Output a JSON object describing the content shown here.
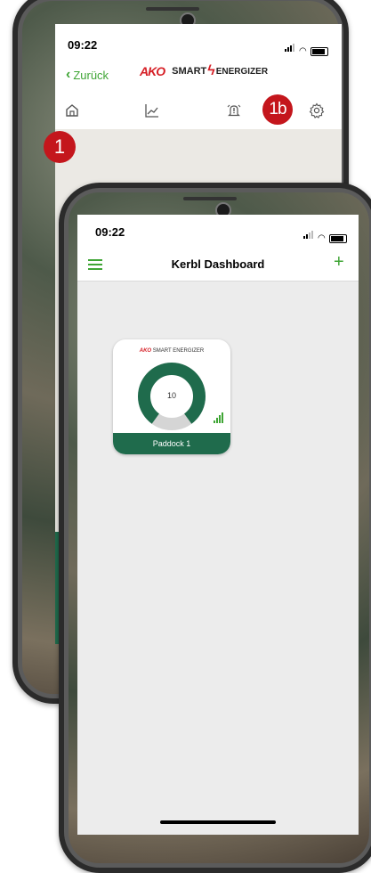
{
  "back_screen": {
    "time": "09:22",
    "back_label": "Zurück",
    "brand_left": "AKO",
    "brand_smart": "SMART",
    "brand_energizer": "ENERGIZER",
    "nav_icons": [
      "home-icon",
      "chart-icon",
      "alarm-bell-icon",
      "settings-gear-icon"
    ],
    "callout": "1"
  },
  "front_screen": {
    "time": "09:22",
    "title": "Kerbl Dashboard",
    "add_label": "+",
    "callout": "1b",
    "device_card": {
      "logo_a": "AKO",
      "logo_rest": "SMART ENERGIZER",
      "value": "10",
      "name": "Paddock 1",
      "level_fraction": 0.8
    }
  },
  "colors": {
    "accent_green": "#3fa535",
    "dark_green": "#1f6b4c",
    "callout_red": "#c4161c",
    "gauge_grey": "#d5d5d5"
  }
}
